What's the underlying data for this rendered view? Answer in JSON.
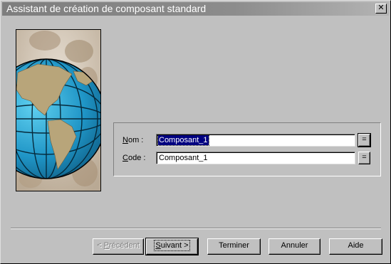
{
  "window": {
    "title": "Assistant de création de composant standard",
    "close_glyph": "✕"
  },
  "fields": [
    {
      "label_prefix": "",
      "label_key": "N",
      "label_rest": "om :",
      "value": "Composant_1",
      "selected": true
    },
    {
      "label_prefix": "",
      "label_key": "C",
      "label_rest": "ode :",
      "value": "Composant_1",
      "selected": false
    }
  ],
  "eq_button": "=",
  "buttons": {
    "previous": {
      "before": "< ",
      "key": "P",
      "after": "récédent"
    },
    "next": {
      "key": "S",
      "after": "uivant >"
    },
    "finish": "Terminer",
    "cancel": "Annuler",
    "help": "Aide"
  },
  "image": {
    "icon": "globe-illustration"
  }
}
